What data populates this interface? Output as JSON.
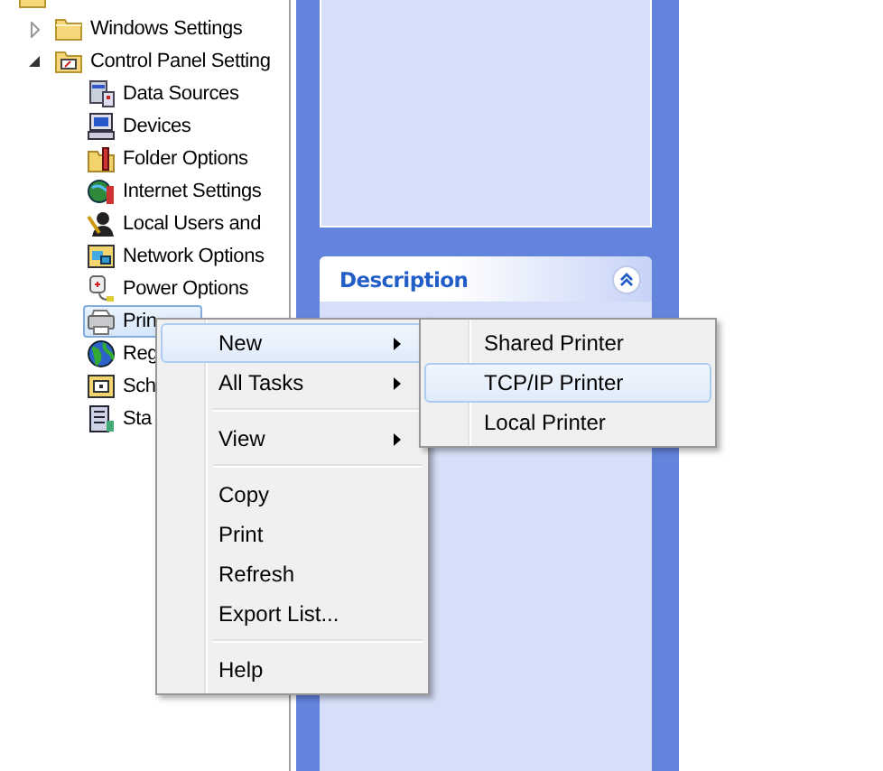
{
  "tree": {
    "items": [
      {
        "children": [
          {
            "label": "Windows Settings",
            "selected": false,
            "expanded": false
          },
          {
            "label": "Control Panel Setting",
            "selected": false,
            "expanded": true,
            "children": [
              {
                "label": "Data Sources",
                "selected": false
              },
              {
                "label": "Devices",
                "selected": false
              },
              {
                "label": "Folder Options",
                "selected": false
              },
              {
                "label": "Internet Settings",
                "selected": false
              },
              {
                "label": "Local Users and",
                "selected": false
              },
              {
                "label": "Network Options",
                "selected": false
              },
              {
                "label": "Power Options",
                "selected": false
              },
              {
                "label": "Prin",
                "selected": true
              },
              {
                "label": "Reg",
                "selected": false
              },
              {
                "label": "Sch",
                "selected": false
              },
              {
                "label": "Sta",
                "selected": false
              }
            ]
          }
        ]
      }
    ]
  },
  "task_pane": {
    "sections": [
      {
        "title": "Description",
        "expanded": true
      }
    ]
  },
  "context_menu": {
    "groups": [
      {
        "items": [
          {
            "label": "New",
            "has_submenu": true,
            "selected": true
          },
          {
            "label": "All Tasks",
            "has_submenu": true,
            "selected": false
          }
        ]
      },
      {
        "items": [
          {
            "label": "View",
            "has_submenu": true,
            "selected": false
          }
        ]
      },
      {
        "items": [
          {
            "label": "Copy",
            "has_submenu": false,
            "selected": false
          },
          {
            "label": "Print",
            "has_submenu": false,
            "selected": false
          },
          {
            "label": "Refresh",
            "has_submenu": false,
            "selected": false
          },
          {
            "label": "Export List...",
            "has_submenu": false,
            "selected": false
          }
        ]
      },
      {
        "items": [
          {
            "label": "Help",
            "has_submenu": false,
            "selected": false
          }
        ]
      }
    ],
    "submenu": {
      "items": [
        {
          "label": "Shared Printer",
          "selected": false
        },
        {
          "label": "TCP/IP Printer",
          "selected": true
        },
        {
          "label": "Local Printer",
          "selected": false
        }
      ]
    }
  }
}
